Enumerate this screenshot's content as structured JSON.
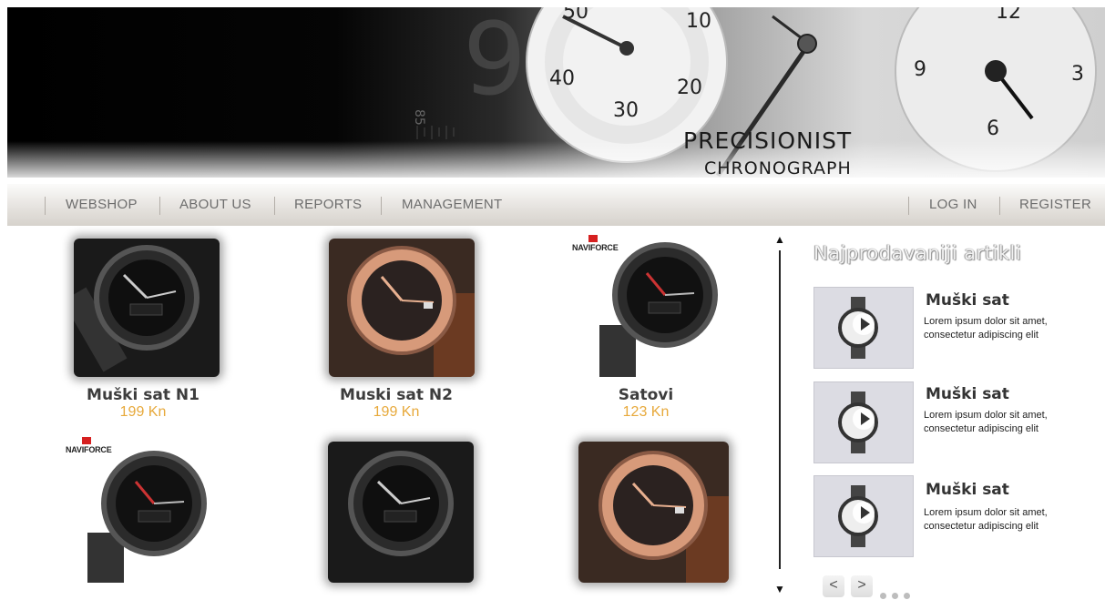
{
  "hero": {
    "brand_line1": "PRECISIONIST",
    "brand_line2": "CHRONOGRAPH",
    "dial_numbers": [
      "50",
      "10",
      "40",
      "20",
      "30",
      "12",
      "9",
      "3",
      "6",
      "85"
    ]
  },
  "nav": {
    "left": [
      "WEBSHOP",
      "ABOUT US",
      "REPORTS",
      "MANAGEMENT"
    ],
    "right": [
      "LOG IN",
      "REGISTER"
    ]
  },
  "products": [
    {
      "name": "Muški sat N1",
      "price": "199 Kn",
      "style": "black"
    },
    {
      "name": "Muski sat N2",
      "price": "199 Kn",
      "style": "rosegold"
    },
    {
      "name": "Satovi",
      "price": "123 Kn",
      "style": "black-red",
      "brand": "NAVIFORCE"
    },
    {
      "style": "black-red",
      "brand": "NAVIFORCE"
    },
    {
      "style": "black"
    },
    {
      "style": "rosegold"
    }
  ],
  "sidebar": {
    "title": "Najprodavaniji artikli",
    "items": [
      {
        "name": "Muški sat",
        "description": "Lorem ipsum dolor sit amet, consectetur adipiscing elit"
      },
      {
        "name": "Muški sat",
        "description": "Lorem ipsum dolor sit amet, consectetur adipiscing elit"
      },
      {
        "name": "Muški sat",
        "description": "Lorem ipsum dolor sit amet, consectetur adipiscing elit"
      }
    ],
    "prev_label": "<",
    "next_label": ">"
  },
  "colors": {
    "price": "#e7a93b",
    "nav_text": "#6d6d6d",
    "accent_red": "#d62020",
    "rose_gold": "#d79a7a"
  }
}
